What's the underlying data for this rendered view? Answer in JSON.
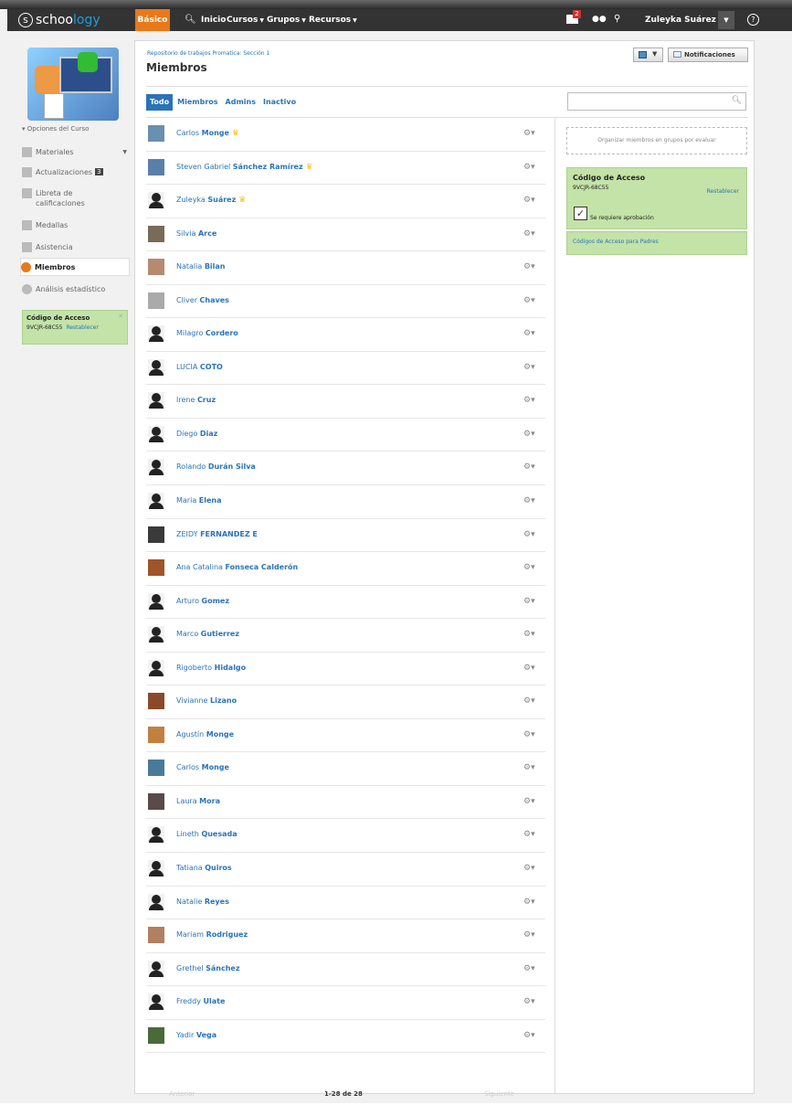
{
  "topnav": {
    "logo": "schoology",
    "mode": "Básico",
    "links": [
      "Inicio",
      "Cursos",
      "Grupos",
      "Recursos"
    ],
    "mail_badge": "2",
    "user": "Zuleyka Suárez"
  },
  "sidebar": {
    "options": "Opciones del Curso",
    "items": [
      {
        "label": "Materiales"
      },
      {
        "label": "Actualizaciones",
        "badge": "3"
      },
      {
        "label": "Libreta de calificaciones"
      },
      {
        "label": "Medallas"
      },
      {
        "label": "Asistencia"
      },
      {
        "label": "Miembros"
      },
      {
        "label": "Análisis estadístico"
      }
    ],
    "access": {
      "title": "Código de Acceso",
      "code": "9VCJR-68C55",
      "reset": "Restablecer"
    }
  },
  "header": {
    "breadcrumb": "Repositorio de trabajos Promatica: Sección 1",
    "title": "Miembros",
    "notifications": "Notificaciones"
  },
  "tabs": [
    "Todo",
    "Miembros",
    "Admins",
    "Inactivo"
  ],
  "members": [
    {
      "first": "Carlos",
      "last": "Monge",
      "admin": true,
      "color": "#6a8fb0"
    },
    {
      "first": "Steven Gabriel",
      "last": "Sánchez Ramírez",
      "admin": true,
      "color": "#5a7fa8"
    },
    {
      "first": "Zuleyka",
      "last": "Suárez",
      "admin": true
    },
    {
      "first": "Silvia",
      "last": "Arce",
      "color": "#7a6a5a"
    },
    {
      "first": "Natalia",
      "last": "Bilan",
      "color": "#b58a70"
    },
    {
      "first": "Cliver",
      "last": "Chaves",
      "color": "#aaaaaa"
    },
    {
      "first": "Milagro",
      "last": "Cordero"
    },
    {
      "first": "LUCIA",
      "last": "COTO"
    },
    {
      "first": "Irene",
      "last": "Cruz"
    },
    {
      "first": "Diego",
      "last": "Diaz"
    },
    {
      "first": "Rolando",
      "last": "Durán Silva"
    },
    {
      "first": "Maria",
      "last": "Elena"
    },
    {
      "first": "ZEIDY",
      "last": "FERNANDEZ E",
      "color": "#3a3a3a"
    },
    {
      "first": "Ana Catalina",
      "last": "Fonseca Calderón",
      "color": "#a0542a"
    },
    {
      "first": "Arturo",
      "last": "Gomez"
    },
    {
      "first": "Marco",
      "last": "Gutierrez"
    },
    {
      "first": "Rigoberto",
      "last": "Hidalgo"
    },
    {
      "first": "Vivianne",
      "last": "Lizano",
      "color": "#8a4a2a"
    },
    {
      "first": "Agustín",
      "last": "Monge",
      "color": "#c08040"
    },
    {
      "first": "Carlos",
      "last": "Monge",
      "color": "#4a7a9a"
    },
    {
      "first": "Laura",
      "last": "Mora",
      "color": "#5a4a4a"
    },
    {
      "first": "Lineth",
      "last": "Quesada"
    },
    {
      "first": "Tatiana",
      "last": "Quiros"
    },
    {
      "first": "Natalie",
      "last": "Reyes"
    },
    {
      "first": "Mariam",
      "last": "Rodriguez",
      "color": "#b08060"
    },
    {
      "first": "Grethel",
      "last": "Sánchez"
    },
    {
      "first": "Freddy",
      "last": "Ulate"
    },
    {
      "first": "Yadir",
      "last": "Vega",
      "color": "#4a6a3a"
    }
  ],
  "pager": {
    "prev": "Anterior",
    "count": "1-28 de 28",
    "next": "Siguiente"
  },
  "right": {
    "organize": "Organizar miembros en grupos por evaluar",
    "access": {
      "title": "Código de Acceso",
      "code": "9VCJR-68C55",
      "reset": "Restablecer",
      "approval": "Se requiere aprobación"
    },
    "parents": "Códigos de Acceso para Padres"
  }
}
